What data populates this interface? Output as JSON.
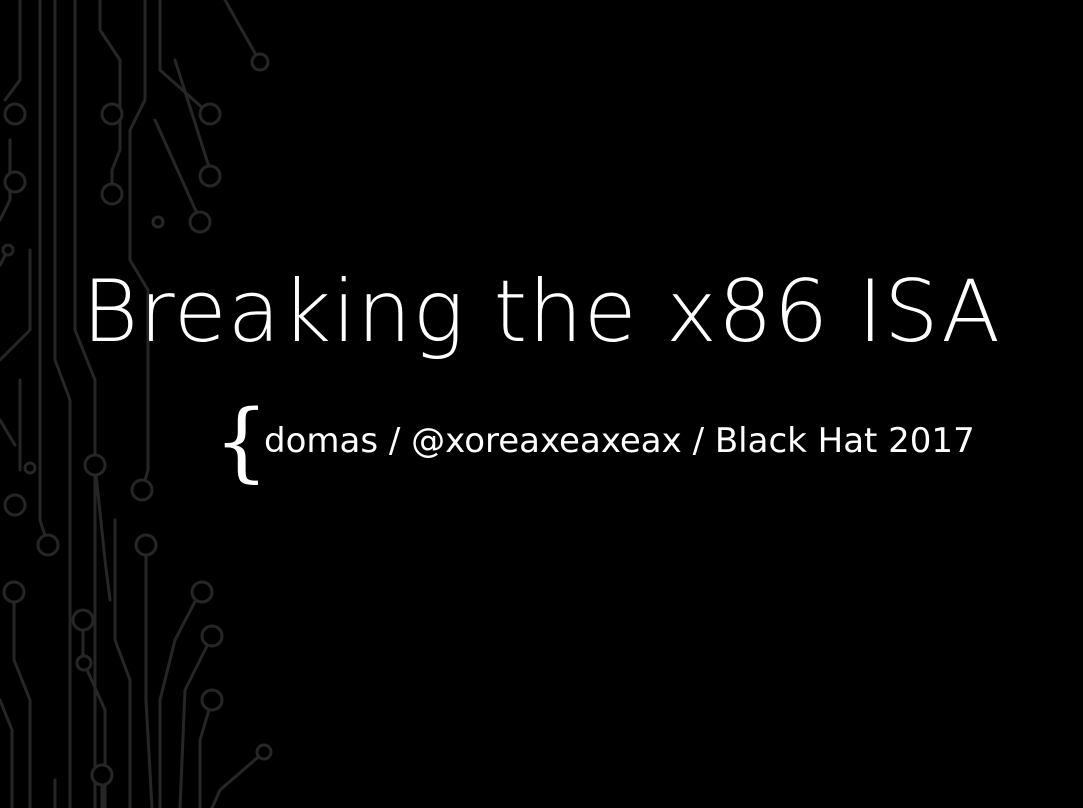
{
  "slide": {
    "title": "Breaking the x86 ISA",
    "brace": "{",
    "subtitle": "domas / @xoreaxeaxeax / Black Hat 2017"
  },
  "theme": {
    "background": "#000000",
    "text_color": "#ffffff",
    "circuit_color": "#262626"
  }
}
